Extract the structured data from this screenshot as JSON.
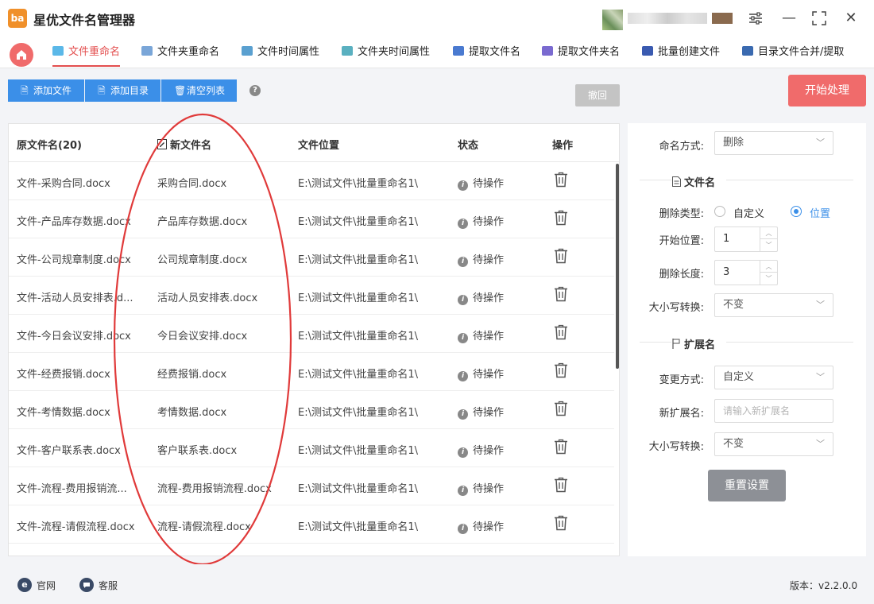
{
  "app": {
    "title": "星优文件名管理器",
    "logo_text": "ba"
  },
  "window_controls": {
    "settings_icon": "sliders-icon",
    "minimize": "—",
    "maximize": "⛶",
    "close": "✕"
  },
  "tabs": [
    {
      "label": "文件重命名",
      "active": true,
      "icon_color": "#5bb8e8"
    },
    {
      "label": "文件夹重命名",
      "active": false,
      "icon_color": "#7aa6d8"
    },
    {
      "label": "文件时间属性",
      "active": false,
      "icon_color": "#5aa0d0"
    },
    {
      "label": "文件夹时间属性",
      "active": false,
      "icon_color": "#5ab0c0"
    },
    {
      "label": "提取文件名",
      "active": false,
      "icon_color": "#4a7ad0"
    },
    {
      "label": "提取文件夹名",
      "active": false,
      "icon_color": "#7a6ad0"
    },
    {
      "label": "批量创建文件",
      "active": false,
      "icon_color": "#3a5ab0"
    },
    {
      "label": "目录文件合并/提取",
      "active": false,
      "icon_color": "#3a6ab0"
    }
  ],
  "toolbar": {
    "add_file": "添加文件",
    "add_dir": "添加目录",
    "clear_list": "清空列表",
    "help": "?",
    "undo": "撤回",
    "start": "开始处理"
  },
  "table": {
    "headers": {
      "orig": "原文件名(20)",
      "new": "新文件名",
      "location": "文件位置",
      "status": "状态",
      "action": "操作"
    },
    "rows": [
      {
        "orig": "文件-采购合同.docx",
        "new": "采购合同.docx",
        "location": "E:\\测试文件\\批量重命名1\\",
        "status": "待操作"
      },
      {
        "orig": "文件-产品库存数据.docx",
        "new": "产品库存数据.docx",
        "location": "E:\\测试文件\\批量重命名1\\",
        "status": "待操作"
      },
      {
        "orig": "文件-公司规章制度.docx",
        "new": "公司规章制度.docx",
        "location": "E:\\测试文件\\批量重命名1\\",
        "status": "待操作"
      },
      {
        "orig": "文件-活动人员安排表.d...",
        "new": "活动人员安排表.docx",
        "location": "E:\\测试文件\\批量重命名1\\",
        "status": "待操作"
      },
      {
        "orig": "文件-今日会议安排.docx",
        "new": "今日会议安排.docx",
        "location": "E:\\测试文件\\批量重命名1\\",
        "status": "待操作"
      },
      {
        "orig": "文件-经费报销.docx",
        "new": "经费报销.docx",
        "location": "E:\\测试文件\\批量重命名1\\",
        "status": "待操作"
      },
      {
        "orig": "文件-考情数据.docx",
        "new": "考情数据.docx",
        "location": "E:\\测试文件\\批量重命名1\\",
        "status": "待操作"
      },
      {
        "orig": "文件-客户联系表.docx",
        "new": "客户联系表.docx",
        "location": "E:\\测试文件\\批量重命名1\\",
        "status": "待操作"
      },
      {
        "orig": "文件-流程-费用报销流...",
        "new": "流程-费用报销流程.docx",
        "location": "E:\\测试文件\\批量重命名1\\",
        "status": "待操作"
      },
      {
        "orig": "文件-流程-请假流程.docx",
        "new": "流程-请假流程.docx",
        "location": "E:\\测试文件\\批量重命名1\\",
        "status": "待操作"
      }
    ]
  },
  "settings": {
    "naming_mode_label": "命名方式:",
    "naming_mode_value": "删除",
    "filename_section": "文件名",
    "delete_type_label": "删除类型:",
    "delete_type_options": [
      "自定义",
      "位置"
    ],
    "delete_type_selected": "位置",
    "start_pos_label": "开始位置:",
    "start_pos_value": "1",
    "delete_len_label": "删除长度:",
    "delete_len_value": "3",
    "case_label": "大小写转换:",
    "case_value": "不变",
    "ext_section": "扩展名",
    "change_mode_label": "变更方式:",
    "change_mode_value": "自定义",
    "new_ext_label": "新扩展名:",
    "new_ext_placeholder": "请输入新扩展名",
    "ext_case_label": "大小写转换:",
    "ext_case_value": "不变",
    "reset": "重置设置"
  },
  "footer": {
    "website": "官网",
    "support": "客服",
    "version": "版本：v2.2.0.0"
  },
  "colors": {
    "accent_red": "#e34e4e",
    "primary_blue": "#3b8fe8",
    "annotation_red": "#e03a3a"
  }
}
